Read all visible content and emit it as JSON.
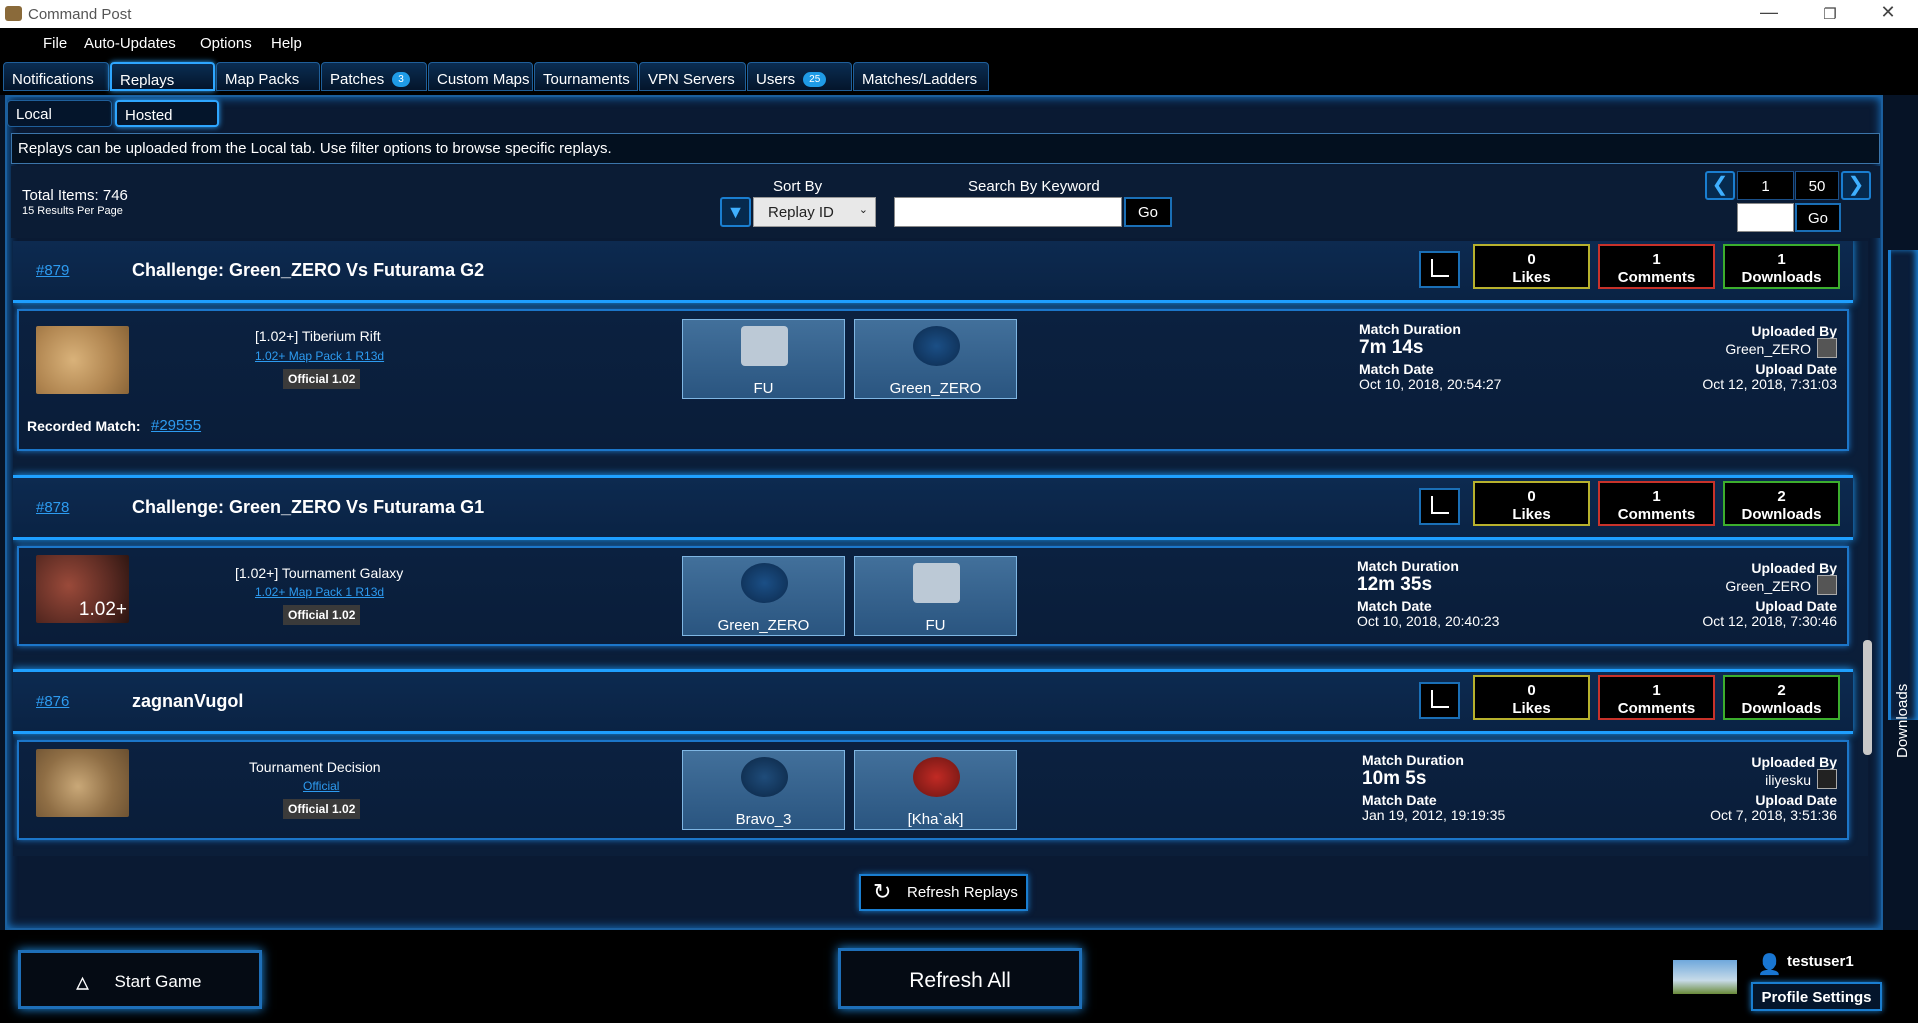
{
  "window": {
    "title": "Command Post"
  },
  "menu": [
    "File",
    "Auto-Updates",
    "Options",
    "Help"
  ],
  "tabs": [
    {
      "label": "Notifications"
    },
    {
      "label": "Replays",
      "selected": true
    },
    {
      "label": "Map Packs"
    },
    {
      "label": "Patches",
      "badge": "3"
    },
    {
      "label": "Custom Maps"
    },
    {
      "label": "Tournaments"
    },
    {
      "label": "VPN Servers"
    },
    {
      "label": "Users",
      "badge": "25"
    },
    {
      "label": "Matches/Ladders"
    }
  ],
  "subtabs": [
    {
      "label": "Local"
    },
    {
      "label": "Hosted",
      "selected": true
    }
  ],
  "info_text": "Replays can be uploaded from the Local tab. Use filter options to browse specific replays.",
  "filters": {
    "total_items": "Total Items: 746",
    "per_page": "15 Results Per Page",
    "sort_label": "Sort By",
    "sort_value": "Replay ID",
    "search_label": "Search By Keyword",
    "search_value": "",
    "go_label": "Go",
    "page_current": "1",
    "page_total": "50",
    "page_go_label": "Go",
    "page_input": ""
  },
  "replays": [
    {
      "id": "#879",
      "title": "Challenge: Green_ZERO Vs Futurama G2",
      "likes": "0",
      "likes_label": "Likes",
      "comments": "1",
      "comments_label": "Comments",
      "downloads": "1",
      "downloads_label": "Downloads",
      "map_name": "[1.02+] Tiberium Rift",
      "map_pack": "1.02+ Map Pack 1 R13d",
      "version": "Official 1.02",
      "players": [
        {
          "name": "FU",
          "icon": "unknown-folder-icon"
        },
        {
          "name": "Green_ZERO",
          "icon": "faction-emblem-icon"
        }
      ],
      "duration_label": "Match Duration",
      "duration": "7m 14s",
      "date_label": "Match Date",
      "date": "Oct 10, 2018, 20:54:27",
      "uploaded_by_label": "Uploaded By",
      "uploaded_by": "Green_ZERO",
      "upload_date_label": "Upload Date",
      "upload_date": "Oct 12, 2018, 7:31:03",
      "recorded_label": "Recorded Match:",
      "recorded_match": "#29555"
    },
    {
      "id": "#878",
      "title": "Challenge: Green_ZERO Vs Futurama G1",
      "likes": "0",
      "likes_label": "Likes",
      "comments": "1",
      "comments_label": "Comments",
      "downloads": "2",
      "downloads_label": "Downloads",
      "map_name": "[1.02+] Tournament Galaxy",
      "map_pack": "1.02+ Map Pack 1 R13d",
      "version": "Official 1.02",
      "map_overlay": "1.02+",
      "players": [
        {
          "name": "Green_ZERO",
          "icon": "faction-emblem-icon"
        },
        {
          "name": "FU",
          "icon": "unknown-folder-icon"
        }
      ],
      "duration_label": "Match Duration",
      "duration": "12m 35s",
      "date_label": "Match Date",
      "date": "Oct 10, 2018, 20:40:23",
      "uploaded_by_label": "Uploaded By",
      "uploaded_by": "Green_ZERO",
      "upload_date_label": "Upload Date",
      "upload_date": "Oct 12, 2018, 7:30:46"
    },
    {
      "id": "#876",
      "title": "zagnanVugol",
      "likes": "0",
      "likes_label": "Likes",
      "comments": "1",
      "comments_label": "Comments",
      "downloads": "2",
      "downloads_label": "Downloads",
      "map_name": "Tournament Decision",
      "map_pack": "Official",
      "version": "Official 1.02",
      "players": [
        {
          "name": "Bravo_3",
          "icon": "gdi-emblem-icon"
        },
        {
          "name": "[Kha`ak]",
          "icon": "nod-emblem-icon"
        }
      ],
      "duration_label": "Match Duration",
      "duration": "10m 5s",
      "date_label": "Match Date",
      "date": "Jan 19, 2012, 19:19:35",
      "uploaded_by_label": "Uploaded By",
      "uploaded_by": "iliyesku",
      "upload_date_label": "Upload Date",
      "upload_date": "Oct 7, 2018, 3:51:36"
    }
  ],
  "refresh_replays": "Refresh Replays",
  "side_downloads": "Downloads",
  "bottom": {
    "start_game": "Start Game",
    "refresh_all": "Refresh All",
    "username": "testuser1",
    "profile_settings": "Profile Settings"
  },
  "colors": {
    "accent": "#1fa0ff",
    "likes_border": "#b7b12d",
    "comments_border": "#c8322a",
    "downloads_border": "#3cae2d"
  }
}
